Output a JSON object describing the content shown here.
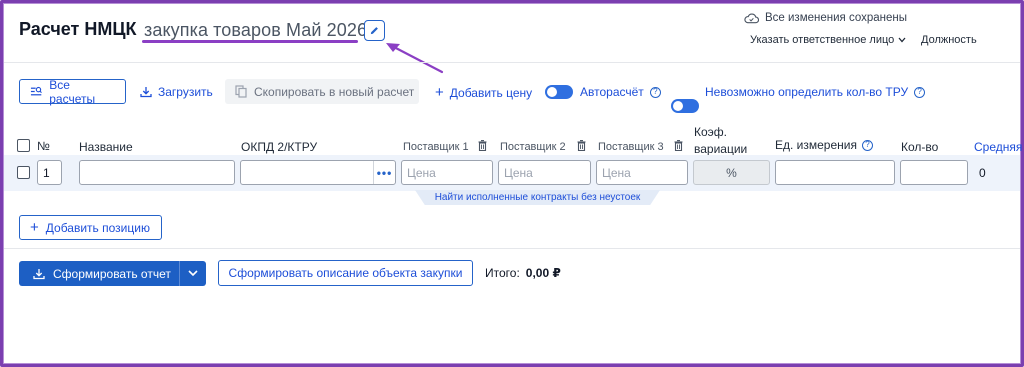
{
  "header": {
    "title": "Расчет НМЦК",
    "calc_name": "закупка товаров Май 2026",
    "saved_status": "Все изменения сохранены",
    "responsible_label": "Указать ответственное лицо",
    "position_label": "Должность"
  },
  "toolbar": {
    "all_calcs": "Все расчеты",
    "upload": "Загрузить",
    "copy_new": "Скопировать в новый расчет",
    "add_price": "Добавить цену",
    "autocalc": "Авторасчёт",
    "cannot_determine": "Невозможно определить кол-во ТРУ",
    "autocalc_on": true,
    "cannot_determine_on": true
  },
  "table": {
    "headers": {
      "num": "№",
      "name": "Название",
      "okpd": "ОКПД 2/КТРУ",
      "supplier1": "Поставщик 1",
      "supplier2": "Поставщик 2",
      "supplier3": "Поставщик 3",
      "coef_line1": "Коэф.",
      "coef_line2": "вариации",
      "unit": "Ед. измерения",
      "qty": "Кол-во",
      "avg": "Средняя"
    },
    "rows": [
      {
        "num": "1",
        "name": "",
        "okpd": "",
        "price_placeholder": "Цена",
        "coef": "%",
        "unit": "",
        "qty": "",
        "avg": "0"
      }
    ],
    "find_contracts": "Найти исполненные контракты без неустоек"
  },
  "actions": {
    "add_position": "Добавить позицию",
    "generate_report": "Сформировать отчет",
    "generate_description": "Сформировать описание объекта закупки",
    "total_label": "Итого:",
    "total_value": "0,00 ₽"
  },
  "colors": {
    "accent": "#1d5fc4",
    "link": "#1d4ed8",
    "annotation": "#8b3fc4"
  }
}
